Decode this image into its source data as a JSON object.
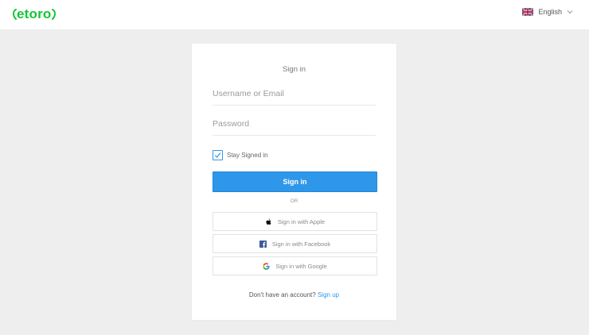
{
  "brand": {
    "name": "etoro",
    "color": "#13c636"
  },
  "header": {
    "language": "English",
    "flag_icon": "uk-flag-icon",
    "chevron_icon": "chevron-down-icon"
  },
  "form": {
    "title": "Sign in",
    "username_placeholder": "Username or Email",
    "password_placeholder": "Password",
    "stay_signed_in_label": "Stay Signed in",
    "stay_signed_in_checked": true,
    "submit_label": "Sign in",
    "divider_text": "OR",
    "apple_label": "Sign in with Apple",
    "facebook_label": "Sign in with Facebook",
    "google_label": "Sign in with Google",
    "no_account_text": "Don't have an account?",
    "signup_link": "Sign up"
  },
  "colors": {
    "accent": "#2f97ea",
    "background": "#eeeeee"
  }
}
